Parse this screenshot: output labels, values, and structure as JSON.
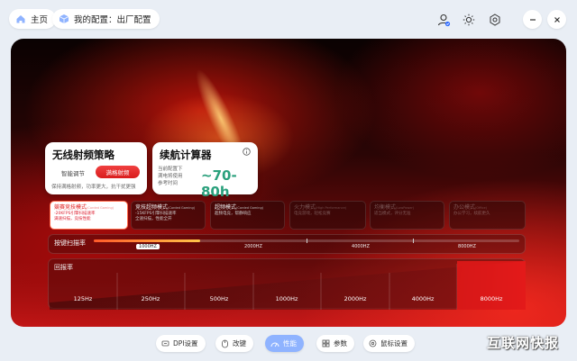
{
  "header": {
    "home_label": "主页",
    "config_label": "我的配置：出厂配置"
  },
  "wireless": {
    "title": "无线射频策略",
    "smart_label": "智能调节",
    "boost_label": "满格射频",
    "desc": "保持满格射频，功率更大，抗干扰更强"
  },
  "battery": {
    "title": "续航计算器",
    "desc_lines": [
      "当前配置下",
      "满电将使用",
      "参考时间"
    ],
    "hours": "~70-80h"
  },
  "modes": [
    {
      "title": "競赛竞技模式",
      "suffix": "(Corded Gaming)",
      "desc1": "-20KFPS引擎扫描速率",
      "desc2": "满速扫描，竞技性能",
      "state": "active"
    },
    {
      "title": "竞技超频模式",
      "suffix": "(Corded Gaming)",
      "desc1": "-15KFPS引擎扫描速率",
      "desc2": "全速扫描，性能全开",
      "state": "normal"
    },
    {
      "title": "超频模式",
      "suffix": "(Corded Gaming)",
      "desc1": "超频电竞，帮静响应",
      "desc2": "",
      "state": "normal"
    },
    {
      "title": "火力模式",
      "suffix": "(High Performance)",
      "desc1": "电竞游戏，轻松竞赛",
      "desc2": "",
      "state": "disabled"
    },
    {
      "title": "均衡模式",
      "suffix": "(LowPower)",
      "desc1": "适当模式，评分无准",
      "desc2": "",
      "state": "disabled"
    },
    {
      "title": "办公模式",
      "suffix": "(Office)",
      "desc1": "办公学习，续航更久",
      "desc2": "",
      "state": "disabled"
    }
  ],
  "scan_rate": {
    "label": "按键扫描率",
    "ticks": [
      "1000HZ",
      "2000HZ",
      "4000HZ",
      "8000HZ"
    ],
    "selected_index": 0
  },
  "polling_rate": {
    "label": "回报率",
    "options": [
      "125Hz",
      "250Hz",
      "500Hz",
      "1000Hz",
      "2000Hz",
      "4000Hz",
      "8000Hz"
    ],
    "selected_index": 6
  },
  "bottom_nav": [
    {
      "label": "DPI设置",
      "icon": "dpi-icon"
    },
    {
      "label": "改键",
      "icon": "mouse-icon"
    },
    {
      "label": "性能",
      "icon": "performance-icon"
    },
    {
      "label": "参数",
      "icon": "params-icon"
    },
    {
      "label": "鼠标设置",
      "icon": "settings-icon"
    }
  ],
  "watermark": "互联网快报",
  "colors": {
    "accent_red": "#e02020",
    "nav_active": "#8fb3ff"
  }
}
